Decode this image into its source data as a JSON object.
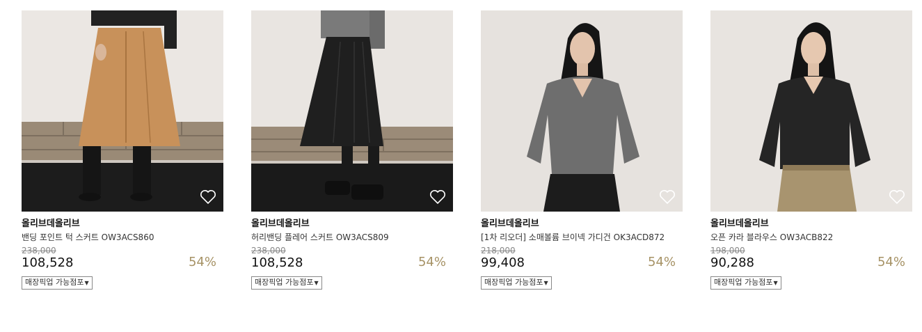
{
  "products": [
    {
      "brand": "올리브데올리브",
      "name": "밴딩 포인트 턱 스커트 OW3ACS860",
      "original_price": "238,000",
      "price": "108,528",
      "discount": "54%",
      "pickup_label": "매장픽업 가능점포",
      "icon": "heart-outline-icon",
      "skirt_color": "#c8915a"
    },
    {
      "brand": "올리브데올리브",
      "name": "허리밴딩 플레어 스커트 OW3ACS809",
      "original_price": "238,000",
      "price": "108,528",
      "discount": "54%",
      "pickup_label": "매장픽업 가능점포",
      "icon": "heart-outline-icon",
      "skirt_color": "#1f1f1f"
    },
    {
      "brand": "올리브데올리브",
      "name": "[1차 리오더] 소매볼륨 브이넥 가디건 OK3ACD872",
      "original_price": "218,000",
      "price": "99,408",
      "discount": "54%",
      "pickup_label": "매장픽업 가능점포",
      "icon": "heart-outline-icon",
      "top_color": "#6e6e6e"
    },
    {
      "brand": "올리브데올리브",
      "name": "오픈 카라 블라우스 OW3ACB822",
      "original_price": "198,000",
      "price": "90,288",
      "discount": "54%",
      "pickup_label": "매장픽업 가능점포",
      "icon": "heart-outline-icon",
      "top_color": "#252525"
    }
  ],
  "colors": {
    "discount": "#a69265",
    "background": "#ffffff"
  }
}
